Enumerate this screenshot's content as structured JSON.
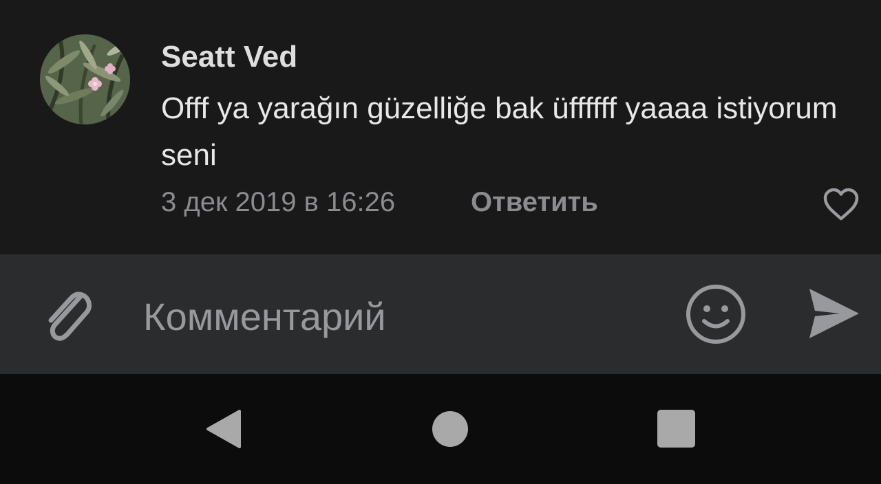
{
  "comment": {
    "author": "Seatt Ved",
    "text": "Offf ya yarağın güzelliğe bak üffffff yaaaa istiyorum seni",
    "date": "3 дек 2019 в 16:26",
    "reply_label": "Ответить",
    "avatar_icon": "avatar-photo",
    "like_icon": "heart-outline-icon"
  },
  "composer": {
    "placeholder": "Комментарий",
    "value": "",
    "attach_icon": "paperclip-icon",
    "emoji_icon": "smiley-icon",
    "send_icon": "send-arrow-icon"
  },
  "system_nav": {
    "back_icon": "triangle-back-icon",
    "home_icon": "circle-home-icon",
    "recents_icon": "square-recents-icon"
  },
  "colors": {
    "background": "#19191a",
    "input_bar": "#2b2c2e",
    "nav_bar": "#0c0c0c",
    "primary_text": "#e8e8e9",
    "secondary_text": "#8c8c90",
    "icon_gray": "#a9a9aa"
  }
}
